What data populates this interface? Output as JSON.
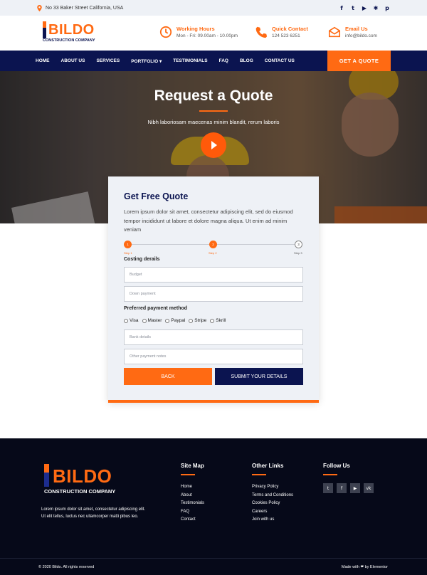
{
  "topbar": {
    "address": "No 33 Baker Street California, USA",
    "socials": [
      {
        "icon": "facebook-icon",
        "glyph": "f"
      },
      {
        "icon": "twitter-icon",
        "glyph": "t"
      },
      {
        "icon": "youtube-icon",
        "glyph": "▶"
      },
      {
        "icon": "yelp-icon",
        "glyph": "✱"
      },
      {
        "icon": "pinterest-icon",
        "glyph": "p"
      }
    ]
  },
  "header": {
    "logo_text": "BILDO",
    "logo_sub": "CONSTRUCTION COMPANY",
    "hours_title": "Working Hours",
    "hours_value": "Mon - Fri: 09.00am - 10.00pm",
    "call_title": "Quick Contact",
    "call_value": "124 523 6251",
    "email_title": "Email Us",
    "email_value": "info@bildo.com"
  },
  "nav": {
    "items": [
      "HOME",
      "ABOUT US",
      "SERVICES",
      "PORTFOLIO ▾",
      "TESTIMONIALS",
      "FAQ",
      "BLOG",
      "CONTACT US"
    ],
    "cta": "GET A QUOTE"
  },
  "hero": {
    "title": "Request a Quote",
    "subtitle": "Nibh laboriosam maecenas minim blandit, rerum laboris"
  },
  "form": {
    "title": "Get Free Quote",
    "description": "Lorem ipsum dolor sit amet, consectetur adipiscing elit, sed do eiusmod tempor incididunt ut labore et dolore magna aliqua. Ut enim ad minim veniam",
    "steps": [
      {
        "num": "1",
        "label": "Step 1"
      },
      {
        "num": "2",
        "label": "Step 2"
      },
      {
        "num": "3",
        "label": "Step 3"
      }
    ],
    "costing_label": "Costing derails",
    "budget_placeholder": "Budget",
    "down_payment_placeholder": "Down payment",
    "payment_method_label": "Preferred payment method",
    "payment_options": [
      "Visa",
      "Master",
      "Paypal",
      "Stripe",
      "Skrill"
    ],
    "bank_placeholder": "Bank details",
    "notes_placeholder": "Other payment notes",
    "back_label": "BACK",
    "submit_label": "SUBMIT YOUR DETAILS"
  },
  "footer": {
    "logo_text": "BILDO",
    "logo_sub": "CONSTRUCTION COMPANY",
    "description": "Lorem ipsum dolor sit amet, consectetur adipiscing elit. Ut elit tellus, luctus nec ullamcorper matti pibus leo.",
    "sitemap_title": "Site Map",
    "sitemap": [
      "Home",
      "About",
      "Testimonials",
      "FAQ",
      "Contact"
    ],
    "other_title": "Other Links",
    "other": [
      "Privacy Policy",
      "Terms and Conditions",
      "Cookies Policy",
      "Careers",
      "Join with us"
    ],
    "follow_title": "Follow Us",
    "follow": [
      {
        "icon": "twitter-icon",
        "glyph": "t"
      },
      {
        "icon": "facebook-icon",
        "glyph": "f"
      },
      {
        "icon": "youtube-icon",
        "glyph": "▶"
      },
      {
        "icon": "vk-icon",
        "glyph": "vk"
      }
    ],
    "copyright": "© 2020 Bildo. All rights reserved",
    "made_with": "Made with ❤ by Elementor"
  },
  "colors": {
    "accent": "#ff6a13",
    "navy": "#0b1450",
    "footer_bg": "#060919"
  }
}
